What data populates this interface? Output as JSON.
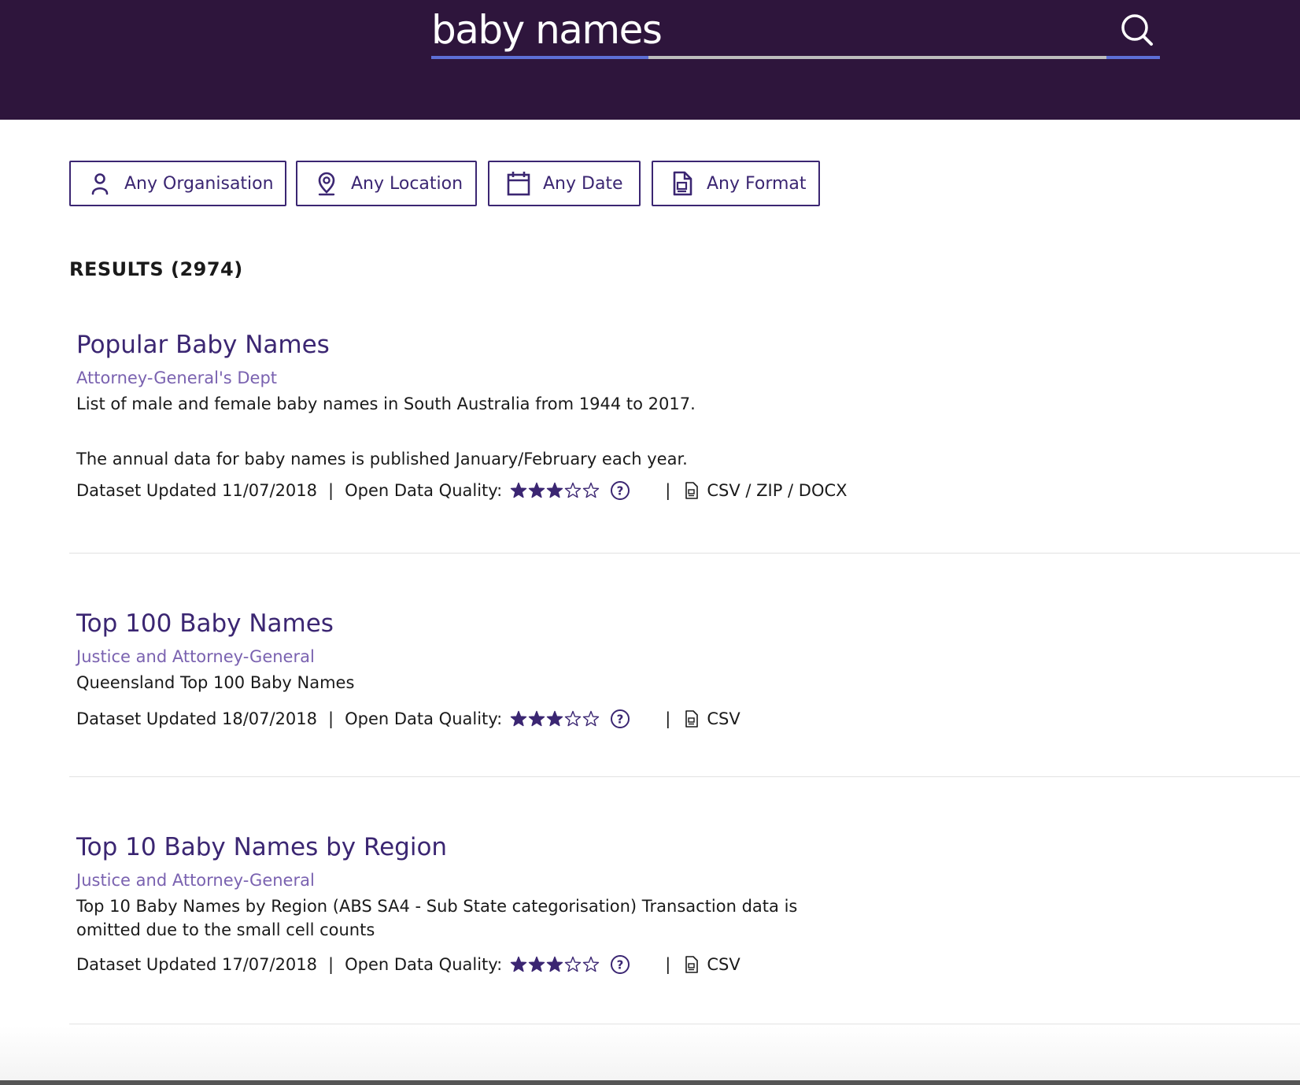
{
  "search": {
    "query": "baby names"
  },
  "filters": [
    {
      "label": "Any Organisation",
      "icon": "user-icon"
    },
    {
      "label": "Any Location",
      "icon": "location-pin-icon"
    },
    {
      "label": "Any Date",
      "icon": "calendar-icon"
    },
    {
      "label": "Any Format",
      "icon": "document-icon"
    }
  ],
  "results_header": "RESULTS (2974)",
  "results": [
    {
      "title": "Popular Baby Names",
      "organisation": "Attorney-General's Dept",
      "description_lines": [
        "List of male and female baby names in South Australia from 1944 to 2017.",
        "",
        "The annual data for baby names is published January/February each year."
      ],
      "updated": "Dataset Updated 11/07/2018",
      "quality_label": "Open Data Quality:",
      "quality_rating": 3,
      "quality_max": 5,
      "formats": "CSV / ZIP / DOCX"
    },
    {
      "title": "Top 100 Baby Names",
      "organisation": "Justice and Attorney-General",
      "description_lines": [
        "Queensland Top 100 Baby Names"
      ],
      "updated": "Dataset Updated 18/07/2018",
      "quality_label": "Open Data Quality:",
      "quality_rating": 3,
      "quality_max": 5,
      "formats": "CSV"
    },
    {
      "title": "Top 10 Baby Names by Region",
      "organisation": "Justice and Attorney-General",
      "description_lines": [
        "Top 10 Baby Names by Region (ABS SA4 - Sub State categorisation) Transaction data is",
        "omitted due to the small cell counts"
      ],
      "updated": "Dataset Updated 17/07/2018",
      "quality_label": "Open Data Quality:",
      "quality_rating": 3,
      "quality_max": 5,
      "formats": "CSV"
    }
  ],
  "separator": "|",
  "colors": {
    "header_bg": "#2e153c",
    "accent": "#5d6fd6",
    "primary": "#3b2672",
    "org_link": "#7a62b0"
  }
}
